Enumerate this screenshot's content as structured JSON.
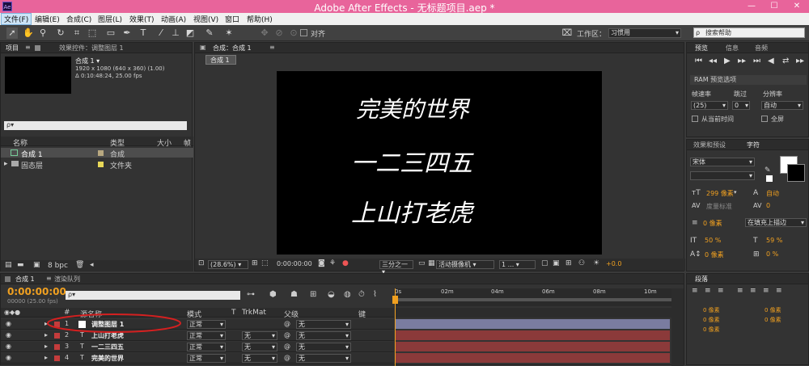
{
  "app": {
    "title": "Adobe After Effects - 无标题项目.aep *",
    "logo": "Ae",
    "min": "—",
    "max": "☐",
    "close": "✕"
  },
  "menu": [
    "文件(F)",
    "编辑(E)",
    "合成(C)",
    "图层(L)",
    "效果(T)",
    "动画(A)",
    "视图(V)",
    "窗口",
    "帮助(H)"
  ],
  "toolbar": {
    "align_label": "对齐",
    "workspace_label": "工作区：",
    "workspace_value": "习惯用",
    "search_placeholder": "搜索帮助"
  },
  "project": {
    "tab": "项目",
    "tab2": "效果控件：调整图层 1",
    "comp_name": "合成 1 ▾",
    "comp_info1": "1920 x 1080 (640 x 360) (1.00)",
    "comp_info2": "Δ 0:10:48:24, 25.00 fps",
    "search": "ρ▾",
    "col_name": "名称",
    "col_type": "类型",
    "col_size": "大小",
    "col_extra": "帧",
    "items": [
      {
        "name": "合成 1",
        "type": "合成",
        "color": "#b8a880"
      },
      {
        "name": "固态层",
        "type": "文件夹",
        "color": "#e8d858"
      }
    ],
    "bpc": "8 bpc"
  },
  "comp": {
    "tab": "合成：合成 1",
    "subtab": "合成 1",
    "text_lines": [
      "完美的世界",
      "一二三四五",
      "上山打老虎"
    ],
    "zoom": "(28.6%)",
    "time": "0:00:00:00",
    "res": "三分之一",
    "camera": "活动摄像机",
    "view": "1 ...",
    "exposure": "+0.0"
  },
  "preview": {
    "tab": "预览",
    "tab2": "信息",
    "tab3": "音频",
    "ram": "RAM 预览选项",
    "fr_label": "帧速率",
    "skip_label": "跳过",
    "res_label": "分辨率",
    "fr": "(25)",
    "skip": "0",
    "res": "自动",
    "from_now": "从当前时间",
    "full": "全屏"
  },
  "effects": {
    "tab": "效果和预设",
    "tab2": "字符"
  },
  "character": {
    "font": "宋体",
    "size": "299 像素",
    "leading": "自动",
    "tracking_label": "度量标准",
    "tracking": "0",
    "stroke": "0 像素",
    "stroke_mode": "在填充上描边",
    "vscale": "50 %",
    "hscale": "59 %",
    "baseline": "0 像素",
    "tsume": "0 %"
  },
  "paragraph": {
    "tab": "段落",
    "v1": "0 像素",
    "v2": "0 像素",
    "v3": "0 像素",
    "v4": "0 像素",
    "v5": "0 像素"
  },
  "timeline": {
    "tab": "合成 1",
    "tab2": "渲染队列",
    "timecode": "0:00:00:00",
    "fps": "00000 (25.00 fps)",
    "search": "ρ▾",
    "col_num": "#",
    "col_src": "源名称",
    "col_mode": "模式",
    "col_t": "T",
    "col_trk": "TrkMat",
    "col_parent": "父级",
    "col_key": "键",
    "ruler": [
      "0s",
      "02m",
      "04m",
      "06m",
      "08m",
      "10m"
    ],
    "layers": [
      {
        "num": "1",
        "name": "调整图层 1",
        "mode": "正常",
        "trk": "",
        "parent": "无",
        "color": "#c43c3c"
      },
      {
        "num": "2",
        "name": "上山打老虎",
        "mode": "正常",
        "trk": "无",
        "parent": "无",
        "color": "#c43c3c"
      },
      {
        "num": "3",
        "name": "一二三四五",
        "mode": "正常",
        "trk": "无",
        "parent": "无",
        "color": "#c43c3c"
      },
      {
        "num": "4",
        "name": "完美的世界",
        "mode": "正常",
        "trk": "无",
        "parent": "无",
        "color": "#c43c3c"
      }
    ]
  }
}
